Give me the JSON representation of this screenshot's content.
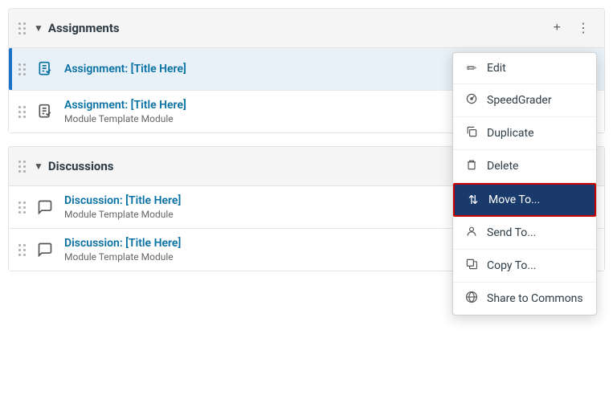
{
  "sections": [
    {
      "id": "assignments",
      "label": "Assignments",
      "items": [
        {
          "id": "assignment-1",
          "title": "Assignment: [Title Here]",
          "subtitle": null,
          "active": true
        },
        {
          "id": "assignment-2",
          "title": "Assignment: [Title Here]",
          "subtitle": "Module Template Module",
          "active": false
        }
      ]
    },
    {
      "id": "discussions",
      "label": "Discussions",
      "items": [
        {
          "id": "discussion-1",
          "title": "Discussion: [Title Here]",
          "subtitle": "Module Template Module",
          "active": false
        },
        {
          "id": "discussion-2",
          "title": "Discussion: [Title Here]",
          "subtitle": "Module Template Module",
          "active": false
        }
      ]
    }
  ],
  "contextMenu": {
    "items": [
      {
        "id": "edit",
        "label": "Edit",
        "icon": "pencil"
      },
      {
        "id": "speedgrader",
        "label": "SpeedGrader",
        "icon": "speedgrader"
      },
      {
        "id": "duplicate",
        "label": "Duplicate",
        "icon": "duplicate"
      },
      {
        "id": "delete",
        "label": "Delete",
        "icon": "trash"
      },
      {
        "id": "move-to",
        "label": "Move To...",
        "icon": "move",
        "highlighted": true
      },
      {
        "id": "send-to",
        "label": "Send To...",
        "icon": "send"
      },
      {
        "id": "copy-to",
        "label": "Copy To...",
        "icon": "copy"
      },
      {
        "id": "share",
        "label": "Share to Commons",
        "icon": "globe"
      }
    ]
  },
  "icons": {
    "drag": "⠿",
    "chevron_down": "▼",
    "plus": "+",
    "three_dot": "⋮",
    "checkmark": "✓",
    "pencil": "✏",
    "speedgrader": "◎",
    "duplicate": "❐",
    "trash": "🗑",
    "move": "⇅",
    "send": "👤",
    "copy": "⊞",
    "globe": "◑"
  }
}
